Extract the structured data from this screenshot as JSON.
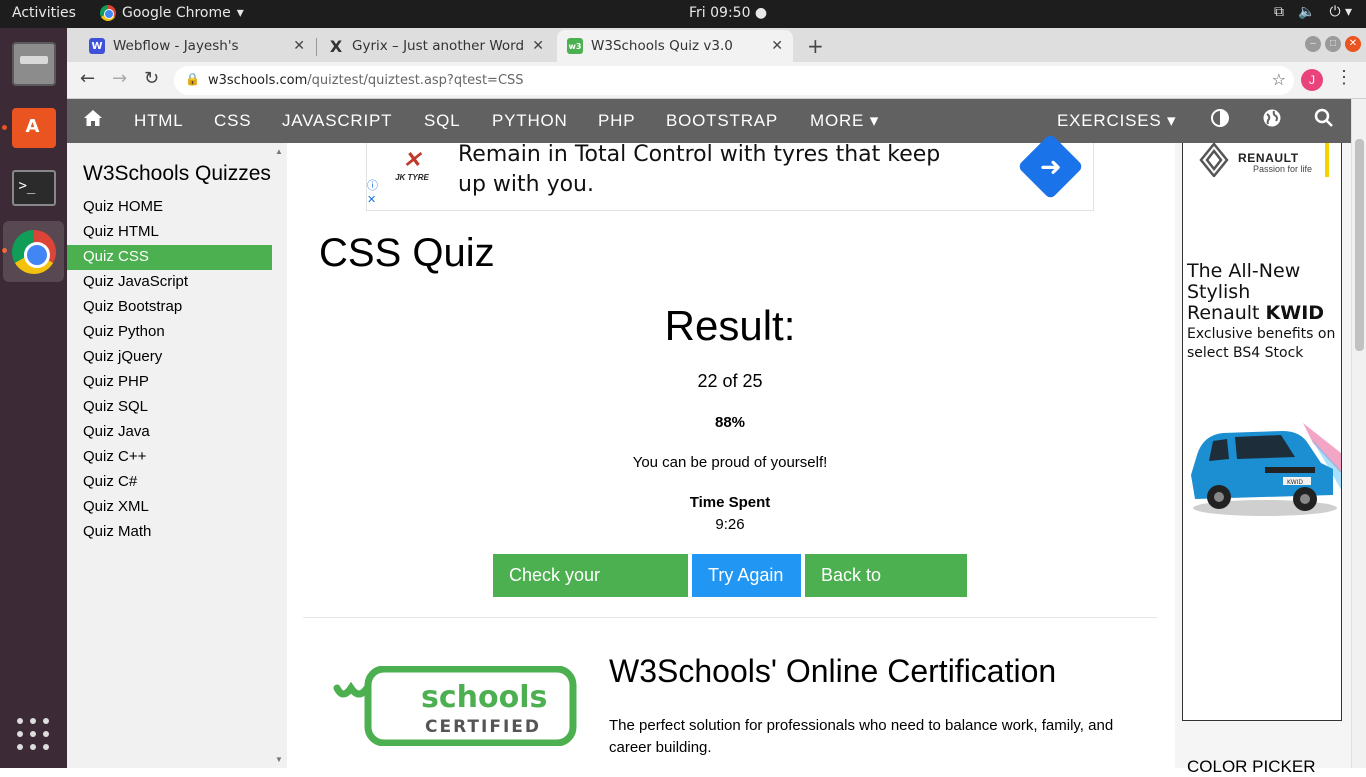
{
  "system": {
    "activities": "Activities",
    "app_name": "Google Chrome",
    "clock": "Fri 09:50 ●"
  },
  "browser": {
    "tabs": [
      {
        "title": "Webflow - Jayesh's",
        "favicon": "W"
      },
      {
        "title": "Gyrix – Just another Word",
        "favicon": "X"
      },
      {
        "title": "W3Schools Quiz v3.0",
        "favicon": "w3"
      }
    ],
    "url_domain": "w3schools.com",
    "url_path": "/quiztest/quiztest.asp?qtest=CSS",
    "profile_initial": "J"
  },
  "w3nav": {
    "items": [
      "HTML",
      "CSS",
      "JAVASCRIPT",
      "SQL",
      "PYTHON",
      "PHP",
      "BOOTSTRAP",
      "MORE ▾"
    ],
    "exercises": "EXERCISES ▾"
  },
  "sidebar": {
    "title": "W3Schools Quizzes",
    "links": [
      "Quiz HOME",
      "Quiz HTML",
      "Quiz CSS",
      "Quiz JavaScript",
      "Quiz Bootstrap",
      "Quiz Python",
      "Quiz jQuery",
      "Quiz PHP",
      "Quiz SQL",
      "Quiz Java",
      "Quiz C++",
      "Quiz C#",
      "Quiz XML",
      "Quiz Math"
    ],
    "active_index": 2
  },
  "ad_top": {
    "brand": "JK TYRE",
    "text": "Remain in Total Control with tyres that keep up with you."
  },
  "quiz": {
    "title": "CSS Quiz",
    "result_heading": "Result:",
    "score": "22 of 25",
    "percent": "88%",
    "message": "You can be proud of yourself!",
    "time_label": "Time Spent",
    "time_value": "9:26",
    "buttons": {
      "check": "Check your answers",
      "retry": "Try Again",
      "back": "Back to Quizzes"
    }
  },
  "certification": {
    "logo_top": "schools",
    "logo_bottom": "CERTIFIED",
    "heading": "W3Schools' Online Certification",
    "text": "The perfect solution for professionals who need to balance work, family, and career building."
  },
  "right_ad": {
    "brand": "RENAULT",
    "tagline": "Passion for life",
    "headline_1": "The All-New Stylish",
    "headline_2": "Renault ",
    "headline_bold": "KWID",
    "body": "Exclusive benefits on select BS4 Stock",
    "car_plate": "KWID"
  },
  "color_picker": "COLOR PICKER",
  "colors": {
    "w3_green": "#4caf50",
    "w3_blue": "#2196f3",
    "nav_gray": "#616161",
    "ubuntu_orange": "#e95420"
  }
}
